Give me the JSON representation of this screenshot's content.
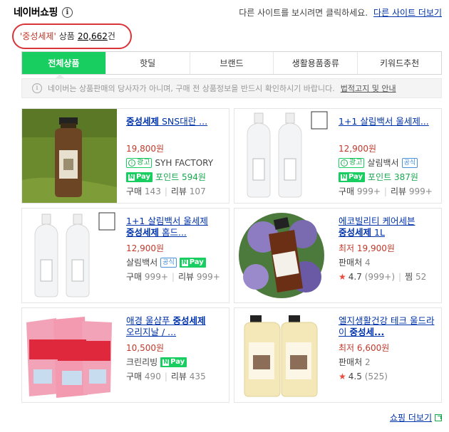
{
  "header": {
    "title": "네이버쇼핑",
    "info_glyph": "i",
    "right_text": "다른 사이트를 보시려면 클릭하세요.",
    "right_link": "다른 사이트 더보기"
  },
  "query": {
    "term": "'중성세제'",
    "label": "상품",
    "count": "20,662",
    "unit": "건"
  },
  "tabs": [
    "전체상품",
    "핫딜",
    "브랜드",
    "생활용품종류",
    "키워드추천"
  ],
  "notice": {
    "glyph": "i",
    "text": "네이버는 상품판매의 당사자가 아니며, 구매 전 상품정보을 반드시 확인하시기 바랍니다.",
    "link": "법적고지 및 안내"
  },
  "labels": {
    "buy": "구매",
    "review": "리뷰",
    "seller": "판매처",
    "jjim": "찜",
    "ad": "광고",
    "official": "공식",
    "npay": "Pay",
    "npay_n": "N",
    "ad_i": "i",
    "star": "★",
    "sep": "|"
  },
  "products": [
    {
      "title_bold": "중성세제",
      "title_rest": " SNS대란 ...",
      "price": "19,800원",
      "seller": "SYH FACTORY",
      "point": "포인트 594원",
      "buy_count": "143",
      "review_count": "107"
    },
    {
      "title_pre": "1+1 살림백서 울세제",
      "title_bold": "",
      "title_rest": "...",
      "price": "12,900원",
      "seller": "살림백서",
      "point": "포인트 387원",
      "buy_count": "999+",
      "review_count": "999+"
    },
    {
      "title_pre": "1+1 살림백서 울세제",
      "title_bold": "중성세제",
      "title_rest": " 홈드...",
      "price": "12,900원",
      "seller": "살림백서",
      "buy_count": "999+",
      "review_count": "999+"
    },
    {
      "title_pre": "에코빌리티 케어세븐",
      "title_bold": "중성세제",
      "title_rest": " 1L",
      "price": "최저 19,900원",
      "seller_count": "4",
      "rating": "4.7",
      "rating_count": "(999+)",
      "jjim_count": "52"
    },
    {
      "title_pre": "애경 울샴푸",
      "title_bold": "중성세제",
      "title_rest": "오리지날 / ...",
      "price": "10,500원",
      "seller": "크린리빙",
      "buy_count": "490",
      "review_count": "435"
    },
    {
      "title_pre": "엘지생활건강 테크 울드라이",
      "title_bold": "중성세...",
      "title_rest": "",
      "price": "최저 6,600원",
      "seller_count": "2",
      "rating": "4.5",
      "rating_count": "(525)"
    }
  ],
  "footer": {
    "link": "쇼핑 더보기"
  },
  "colors": {
    "accent": "#19ce60",
    "price": "#c0392b",
    "link": "#0033aa",
    "highlight_border": "#d9343a"
  }
}
